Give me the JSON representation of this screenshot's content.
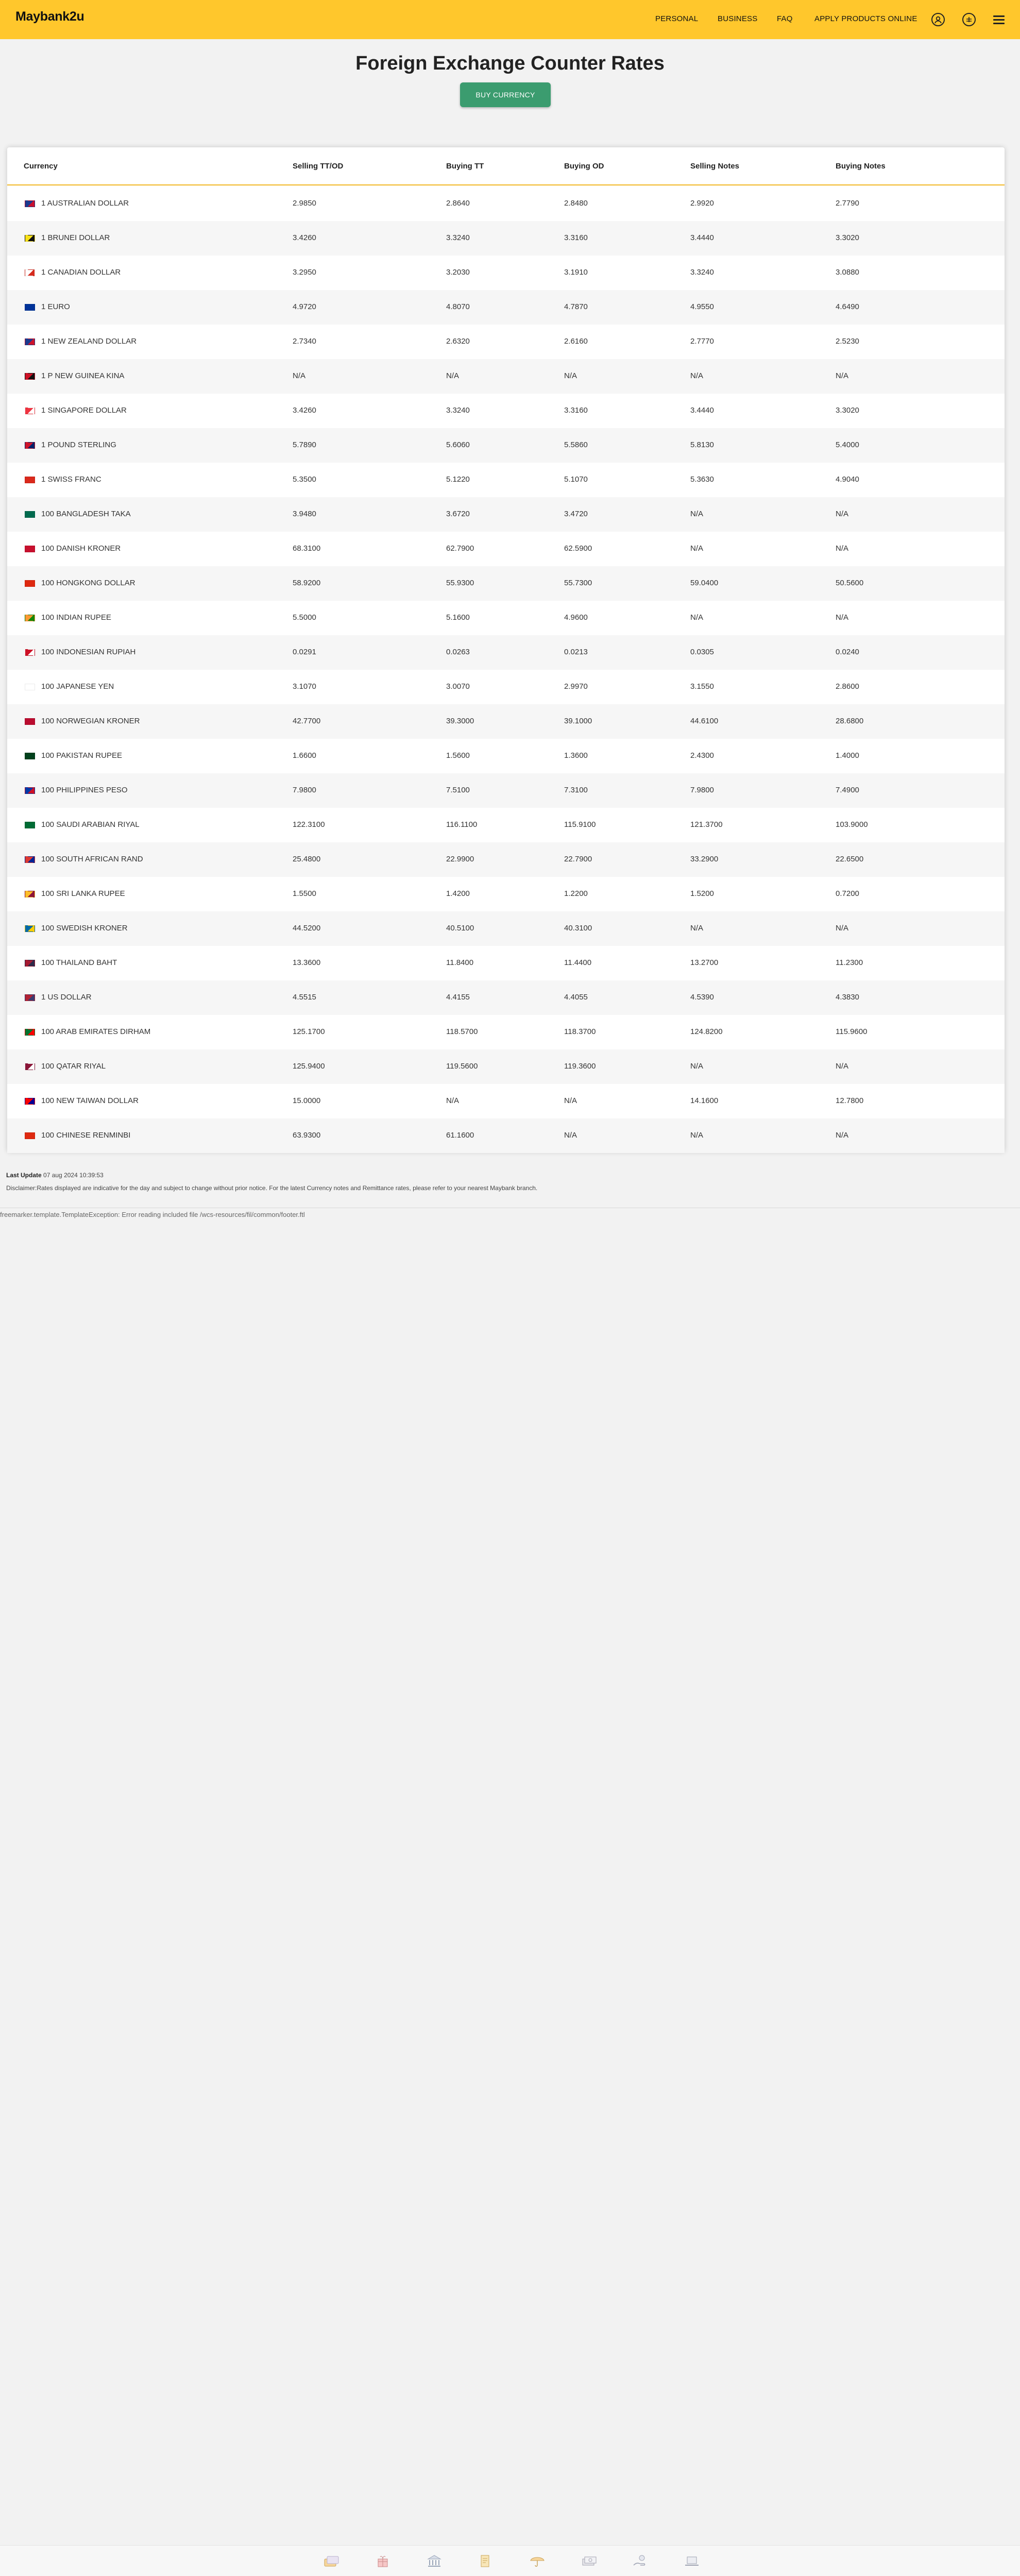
{
  "header": {
    "logo": "Maybank2u",
    "nav": [
      "PERSONAL",
      "BUSINESS",
      "FAQ",
      "APPLY PRODUCTS ONLINE"
    ]
  },
  "page": {
    "title": "Foreign Exchange Counter Rates",
    "buy_button": "BUY CURRENCY"
  },
  "table": {
    "columns": [
      "Currency",
      "Selling TT/OD",
      "Buying TT",
      "Buying OD",
      "Selling Notes",
      "Buying Notes"
    ],
    "rows": [
      {
        "currency": "1 AUSTRALIAN DOLLAR",
        "selling_tt_od": "2.9850",
        "buying_tt": "2.8640",
        "buying_od": "2.8480",
        "selling_notes": "2.9920",
        "buying_notes": "2.7790",
        "flag": [
          "#1a3a8f",
          "#c8102e"
        ]
      },
      {
        "currency": "1 BRUNEI DOLLAR",
        "selling_tt_od": "3.4260",
        "buying_tt": "3.3240",
        "buying_od": "3.3160",
        "selling_notes": "3.4440",
        "buying_notes": "3.3020",
        "flag": [
          "#f7e017",
          "#111111"
        ]
      },
      {
        "currency": "1 CANADIAN DOLLAR",
        "selling_tt_od": "3.2950",
        "buying_tt": "3.2030",
        "buying_od": "3.1910",
        "selling_notes": "3.3240",
        "buying_notes": "3.0880",
        "flag": [
          "#ffffff",
          "#d52b1e"
        ]
      },
      {
        "currency": "1 EURO",
        "selling_tt_od": "4.9720",
        "buying_tt": "4.8070",
        "buying_od": "4.7870",
        "selling_notes": "4.9550",
        "buying_notes": "4.6490",
        "flag": [
          "#003399",
          "#003399"
        ]
      },
      {
        "currency": "1 NEW ZEALAND DOLLAR",
        "selling_tt_od": "2.7340",
        "buying_tt": "2.6320",
        "buying_od": "2.6160",
        "selling_notes": "2.7770",
        "buying_notes": "2.5230",
        "flag": [
          "#1a3a8f",
          "#cc142b"
        ]
      },
      {
        "currency": "1 P NEW GUINEA KINA",
        "selling_tt_od": "N/A",
        "buying_tt": "N/A",
        "buying_od": "N/A",
        "selling_notes": "N/A",
        "buying_notes": "N/A",
        "flag": [
          "#ce1126",
          "#111111"
        ]
      },
      {
        "currency": "1 SINGAPORE DOLLAR",
        "selling_tt_od": "3.4260",
        "buying_tt": "3.3240",
        "buying_od": "3.3160",
        "selling_notes": "3.4440",
        "buying_notes": "3.3020",
        "flag": [
          "#ef3340",
          "#ffffff"
        ]
      },
      {
        "currency": "1 POUND STERLING",
        "selling_tt_od": "5.7890",
        "buying_tt": "5.6060",
        "buying_od": "5.5860",
        "selling_notes": "5.8130",
        "buying_notes": "5.4000",
        "flag": [
          "#cf142b",
          "#012169"
        ]
      },
      {
        "currency": "1 SWISS FRANC",
        "selling_tt_od": "5.3500",
        "buying_tt": "5.1220",
        "buying_od": "5.1070",
        "selling_notes": "5.3630",
        "buying_notes": "4.9040",
        "flag": [
          "#da291c",
          "#da291c"
        ]
      },
      {
        "currency": "100 BANGLADESH TAKA",
        "selling_tt_od": "3.9480",
        "buying_tt": "3.6720",
        "buying_od": "3.4720",
        "selling_notes": "N/A",
        "buying_notes": "N/A",
        "flag": [
          "#006a4e",
          "#006a4e"
        ]
      },
      {
        "currency": "100 DANISH KRONER",
        "selling_tt_od": "68.3100",
        "buying_tt": "62.7900",
        "buying_od": "62.5900",
        "selling_notes": "N/A",
        "buying_notes": "N/A",
        "flag": [
          "#c8102e",
          "#c8102e"
        ]
      },
      {
        "currency": "100 HONGKONG DOLLAR",
        "selling_tt_od": "58.9200",
        "buying_tt": "55.9300",
        "buying_od": "55.7300",
        "selling_notes": "59.0400",
        "buying_notes": "50.5600",
        "flag": [
          "#de2910",
          "#de2910"
        ]
      },
      {
        "currency": "100 INDIAN RUPEE",
        "selling_tt_od": "5.5000",
        "buying_tt": "5.1600",
        "buying_od": "4.9600",
        "selling_notes": "N/A",
        "buying_notes": "N/A",
        "flag": [
          "#ff9933",
          "#138808"
        ]
      },
      {
        "currency": "100 INDONESIAN RUPIAH",
        "selling_tt_od": "0.0291",
        "buying_tt": "0.0263",
        "buying_od": "0.0213",
        "selling_notes": "0.0305",
        "buying_notes": "0.0240",
        "flag": [
          "#ce1126",
          "#ffffff"
        ]
      },
      {
        "currency": "100 JAPANESE YEN",
        "selling_tt_od": "3.1070",
        "buying_tt": "3.0070",
        "buying_od": "2.9970",
        "selling_notes": "3.1550",
        "buying_notes": "2.8600",
        "flag": [
          "#ffffff",
          "#ffffff"
        ]
      },
      {
        "currency": "100 NORWEGIAN KRONER",
        "selling_tt_od": "42.7700",
        "buying_tt": "39.3000",
        "buying_od": "39.1000",
        "selling_notes": "44.6100",
        "buying_notes": "28.6800",
        "flag": [
          "#ba0c2f",
          "#ba0c2f"
        ]
      },
      {
        "currency": "100 PAKISTAN RUPEE",
        "selling_tt_od": "1.6600",
        "buying_tt": "1.5600",
        "buying_od": "1.3600",
        "selling_notes": "2.4300",
        "buying_notes": "1.4000",
        "flag": [
          "#01411c",
          "#01411c"
        ]
      },
      {
        "currency": "100 PHILIPPINES PESO",
        "selling_tt_od": "7.9800",
        "buying_tt": "7.5100",
        "buying_od": "7.3100",
        "selling_notes": "7.9800",
        "buying_notes": "7.4900",
        "flag": [
          "#0038a8",
          "#ce1126"
        ]
      },
      {
        "currency": "100 SAUDI ARABIAN RIYAL",
        "selling_tt_od": "122.3100",
        "buying_tt": "116.1100",
        "buying_od": "115.9100",
        "selling_notes": "121.3700",
        "buying_notes": "103.9000",
        "flag": [
          "#006c35",
          "#006c35"
        ]
      },
      {
        "currency": "100 SOUTH AFRICAN RAND",
        "selling_tt_od": "25.4800",
        "buying_tt": "22.9900",
        "buying_od": "22.7900",
        "selling_notes": "33.2900",
        "buying_notes": "22.6500",
        "flag": [
          "#de3831",
          "#002395"
        ]
      },
      {
        "currency": "100 SRI LANKA RUPEE",
        "selling_tt_od": "1.5500",
        "buying_tt": "1.4200",
        "buying_od": "1.2200",
        "selling_notes": "1.5200",
        "buying_notes": "0.7200",
        "flag": [
          "#ffbe29",
          "#8d153a"
        ]
      },
      {
        "currency": "100 SWEDISH KRONER",
        "selling_tt_od": "44.5200",
        "buying_tt": "40.5100",
        "buying_od": "40.3100",
        "selling_notes": "N/A",
        "buying_notes": "N/A",
        "flag": [
          "#006aa7",
          "#fecc00"
        ]
      },
      {
        "currency": "100 THAILAND BAHT",
        "selling_tt_od": "13.3600",
        "buying_tt": "11.8400",
        "buying_od": "11.4400",
        "selling_notes": "13.2700",
        "buying_notes": "11.2300",
        "flag": [
          "#a51931",
          "#2d2a4a"
        ]
      },
      {
        "currency": "1 US DOLLAR",
        "selling_tt_od": "4.5515",
        "buying_tt": "4.4155",
        "buying_od": "4.4055",
        "selling_notes": "4.5390",
        "buying_notes": "4.3830",
        "flag": [
          "#b22234",
          "#3c3b6e"
        ]
      },
      {
        "currency": "100 ARAB EMIRATES DIRHAM",
        "selling_tt_od": "125.1700",
        "buying_tt": "118.5700",
        "buying_od": "118.3700",
        "selling_notes": "124.8200",
        "buying_notes": "115.9600",
        "flag": [
          "#00732f",
          "#ff0000"
        ]
      },
      {
        "currency": "100 QATAR RIYAL",
        "selling_tt_od": "125.9400",
        "buying_tt": "119.5600",
        "buying_od": "119.3600",
        "selling_notes": "N/A",
        "buying_notes": "N/A",
        "flag": [
          "#8a1538",
          "#ffffff"
        ]
      },
      {
        "currency": "100 NEW TAIWAN DOLLAR",
        "selling_tt_od": "15.0000",
        "buying_tt": "N/A",
        "buying_od": "N/A",
        "selling_notes": "14.1600",
        "buying_notes": "12.7800",
        "flag": [
          "#fe0000",
          "#000095"
        ]
      },
      {
        "currency": "100 CHINESE RENMINBI",
        "selling_tt_od": "63.9300",
        "buying_tt": "61.1600",
        "buying_od": "N/A",
        "selling_notes": "N/A",
        "buying_notes": "N/A",
        "flag": [
          "#de2910",
          "#de2910"
        ]
      }
    ]
  },
  "footer": {
    "last_update_label": "Last Update",
    "last_update_value": "07 aug 2024 10:39:53",
    "disclaimer": "Disclaimer:Rates displayed are indicative for the day and subject to change without prior notice. For the latest Currency notes and Remittance rates, please refer to your nearest Maybank branch.",
    "error": "freemarker.template.TemplateException: Error reading included file /wcs-resources/fil/common/footer.ftl"
  },
  "icons": [
    "user-icon",
    "globe-icon",
    "menu-icon"
  ],
  "bottom_icons": [
    "cards-icon",
    "gift-icon",
    "bank-icon",
    "document-icon",
    "umbrella-icon",
    "cash-icon",
    "hand-coin-icon",
    "laptop-icon"
  ],
  "colors": {
    "header_bg": "#ffc72c",
    "button_bg": "#3b9c6f",
    "header_rule": "#f2b826"
  }
}
